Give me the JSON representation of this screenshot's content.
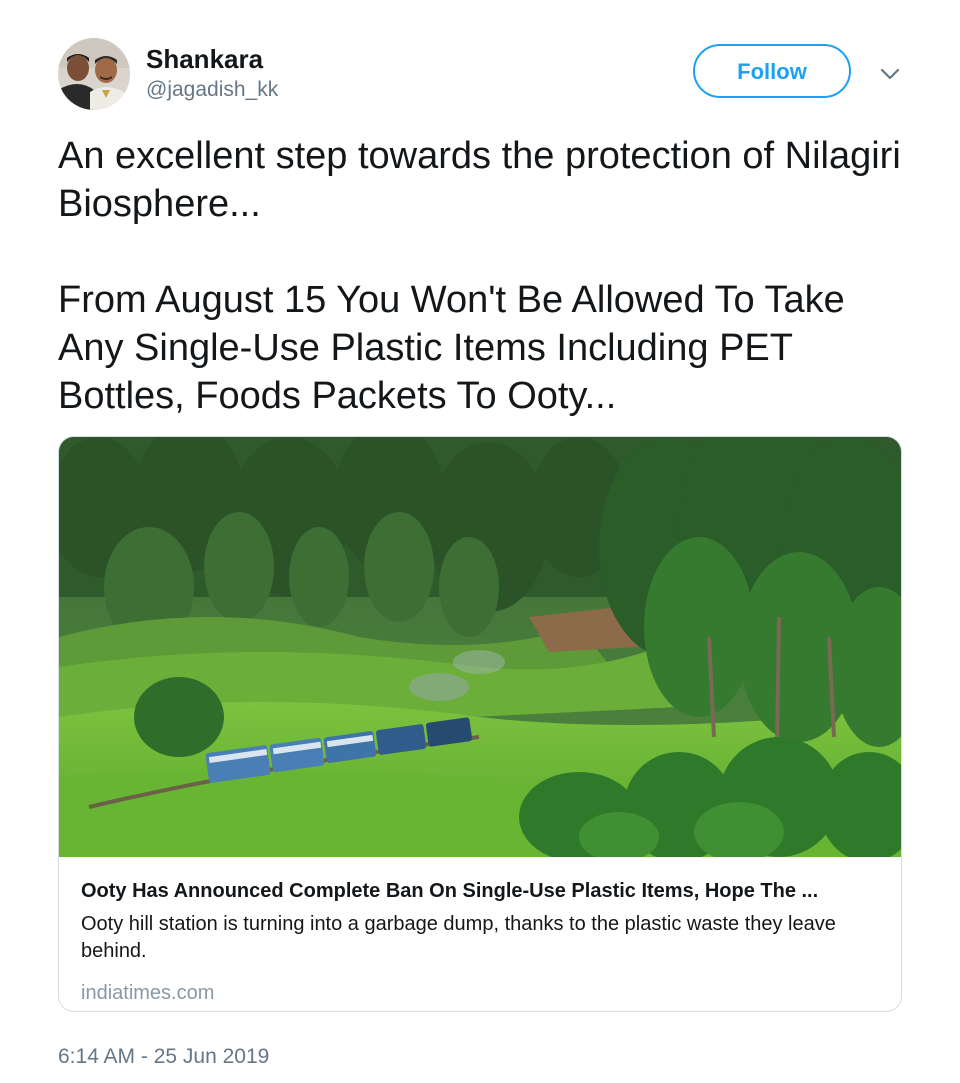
{
  "user": {
    "display_name": "Shankara",
    "handle": "@jagadish_kk"
  },
  "header": {
    "follow_label": "Follow",
    "more_icon": "chevron-down-icon"
  },
  "tweet": {
    "paragraphs": [
      "An excellent step towards the protection of Nilagiri Biosphere...",
      "From August 15 You Won't Be Allowed To Take Any Single-Use Plastic Items Including PET Bottles, Foods Packets To Ooty..."
    ],
    "timestamp": "6:14 AM - 25 Jun 2019"
  },
  "card": {
    "title": "Ooty Has Announced Complete Ban On Single-Use Plastic Items, Hope The ...",
    "description": "Ooty hill station is turning into a garbage dump, thanks to the plastic waste they leave behind.",
    "domain": "indiatimes.com"
  },
  "colors": {
    "accent": "#1da1f2",
    "text_primary": "#14171a",
    "text_secondary": "#657786",
    "border": "#d6dde3"
  }
}
